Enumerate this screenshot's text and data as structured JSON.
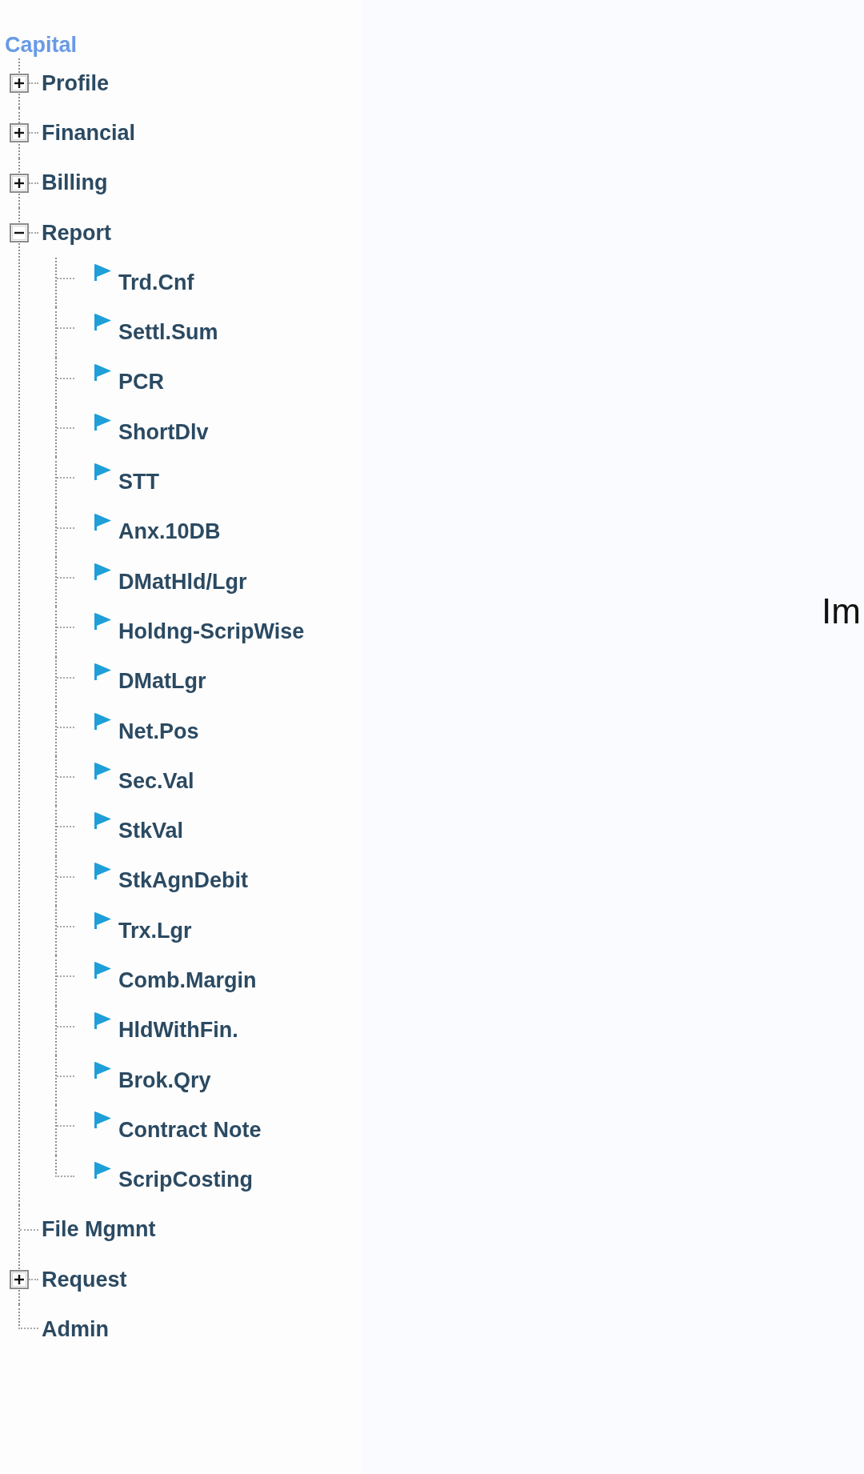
{
  "tree": {
    "root": "Capital",
    "items": [
      {
        "kind": "branch",
        "label": "Profile",
        "expanded": false
      },
      {
        "kind": "branch",
        "label": "Financial",
        "expanded": false
      },
      {
        "kind": "branch",
        "label": "Billing",
        "expanded": false
      },
      {
        "kind": "branch",
        "label": "Report",
        "expanded": true,
        "children": [
          {
            "label": "Trd.Cnf"
          },
          {
            "label": "Settl.Sum"
          },
          {
            "label": "PCR"
          },
          {
            "label": "ShortDlv"
          },
          {
            "label": "STT"
          },
          {
            "label": "Anx.10DB"
          },
          {
            "label": "DMatHld/Lgr"
          },
          {
            "label": "Holdng-ScripWise"
          },
          {
            "label": "DMatLgr"
          },
          {
            "label": "Net.Pos"
          },
          {
            "label": "Sec.Val"
          },
          {
            "label": "StkVal"
          },
          {
            "label": "StkAgnDebit"
          },
          {
            "label": "Trx.Lgr"
          },
          {
            "label": "Comb.Margin"
          },
          {
            "label": "HldWithFin."
          },
          {
            "label": "Brok.Qry"
          },
          {
            "label": "Contract Note"
          },
          {
            "label": "ScripCosting"
          }
        ]
      },
      {
        "kind": "leaf",
        "label": "File Mgmnt"
      },
      {
        "kind": "branch",
        "label": "Request",
        "expanded": false
      },
      {
        "kind": "leaf",
        "label": "Admin"
      }
    ]
  },
  "content": {
    "text": "Im"
  }
}
